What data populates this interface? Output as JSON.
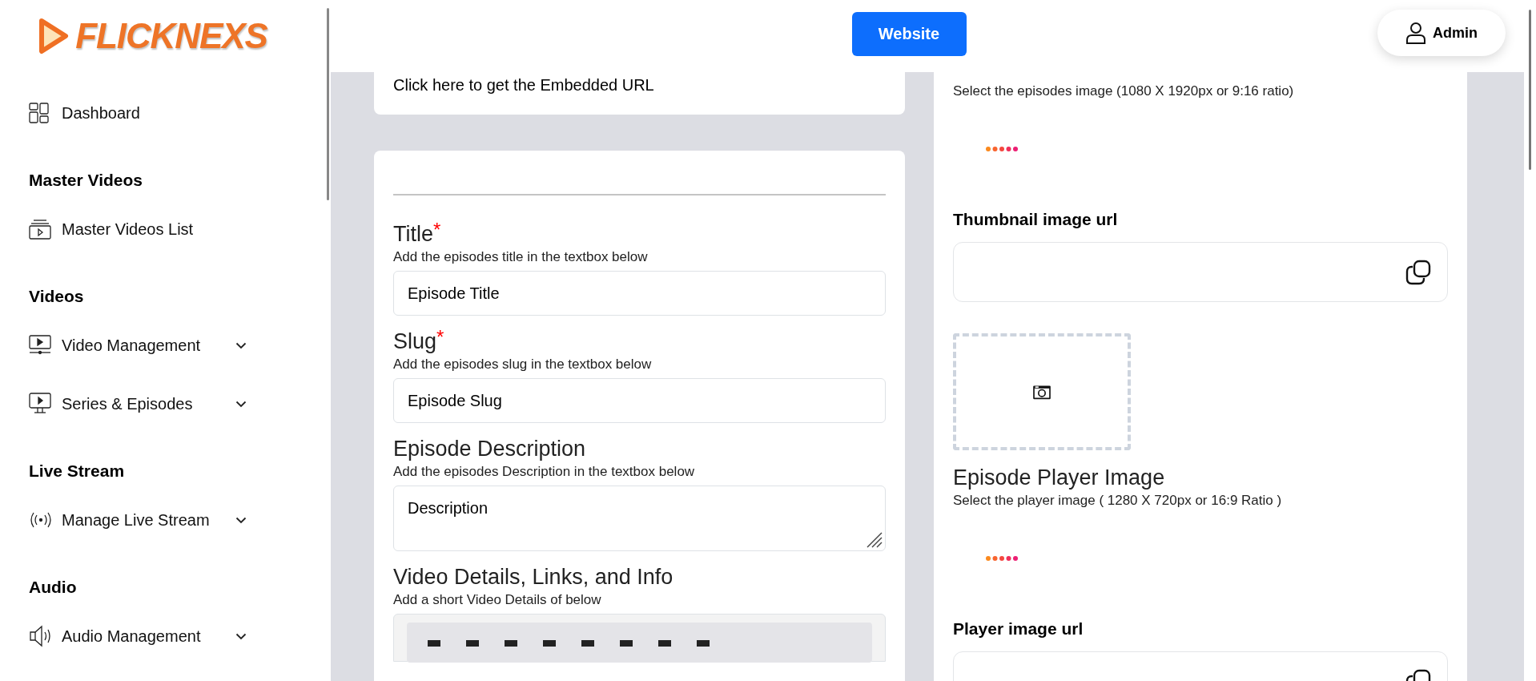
{
  "logo": {
    "text": "FLICKNEXS"
  },
  "sidebar": {
    "sections": [
      {
        "items": [
          {
            "label": "Dashboard",
            "expandable": false
          }
        ]
      },
      {
        "heading": "Master Videos",
        "items": [
          {
            "label": "Master Videos List",
            "expandable": false
          }
        ]
      },
      {
        "heading": "Videos",
        "items": [
          {
            "label": "Video Management",
            "expandable": true
          },
          {
            "label": "Series & Episodes",
            "expandable": true
          }
        ]
      },
      {
        "heading": "Live Stream",
        "items": [
          {
            "label": "Manage Live Stream",
            "expandable": true
          }
        ]
      },
      {
        "heading": "Audio",
        "items": [
          {
            "label": "Audio Management",
            "expandable": true
          }
        ]
      }
    ]
  },
  "header": {
    "website_button": "Website",
    "user_button": "Admin"
  },
  "embed_card": {
    "text": "Click here to get the Embedded URL"
  },
  "form": {
    "fields": [
      {
        "kind": "input",
        "label": "Title",
        "required_mark": "*",
        "hint": "Add the episodes title in the textbox below",
        "value": "Episode Title"
      },
      {
        "kind": "input",
        "label": "Slug",
        "required_mark": "*",
        "hint": "Add the episodes slug in the textbox below",
        "value": "Episode Slug"
      },
      {
        "kind": "textarea",
        "label": "Episode Description",
        "hint": "Add the episodes Description in the textbox below",
        "value": "Description"
      },
      {
        "kind": "editor",
        "label": "Video Details, Links, and Info",
        "hint": "Add a short Video Details of below"
      }
    ]
  },
  "media_panel": [
    {
      "kind": "hint",
      "text": "Select the episodes image (1080 X 1920px or 9:16 ratio)"
    },
    {
      "kind": "loader"
    },
    {
      "kind": "url_field",
      "label": "Thumbnail image url"
    },
    {
      "kind": "upload_box"
    },
    {
      "kind": "heading",
      "text": "Episode Player Image"
    },
    {
      "kind": "hint",
      "text": "Select the player image ( 1280 X 720px or 16:9 Ratio )"
    },
    {
      "kind": "loader"
    },
    {
      "kind": "url_field",
      "label": "Player image url"
    }
  ]
}
